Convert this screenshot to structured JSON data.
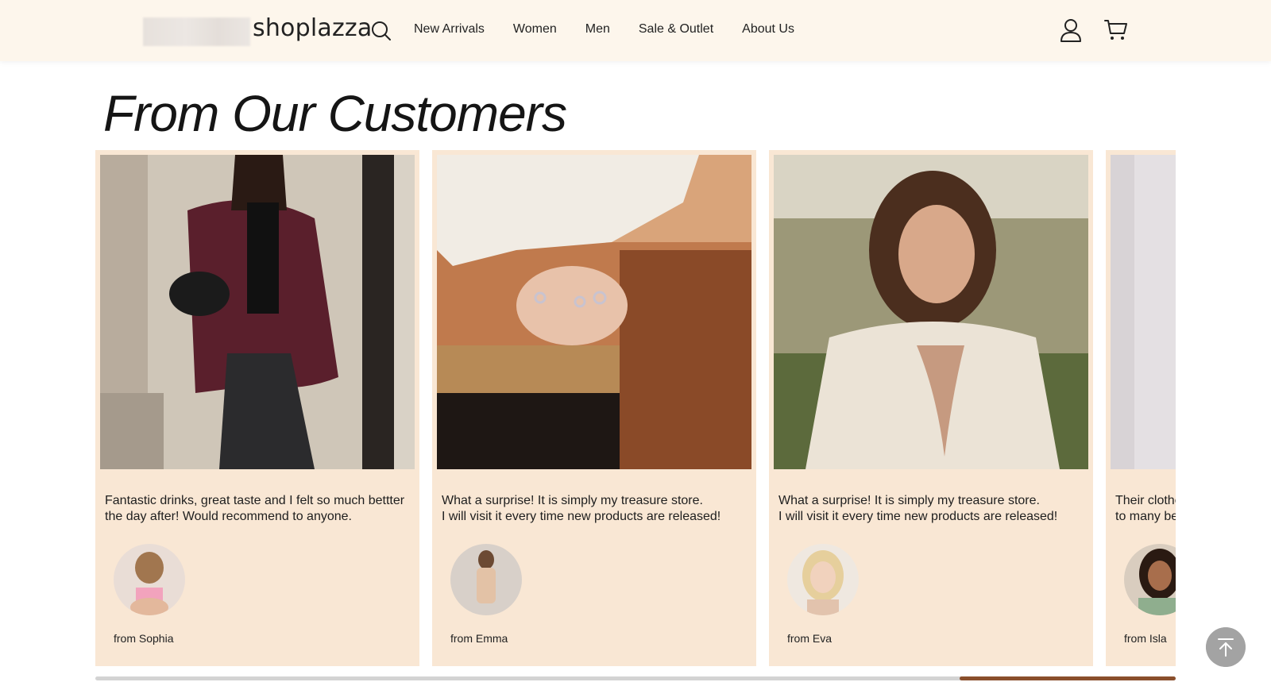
{
  "header": {
    "logo_text": "shoplazza",
    "nav": [
      "New Arrivals",
      "Women",
      "Men",
      "Sale & Outlet",
      "About Us"
    ],
    "icons": [
      "search-icon",
      "account-icon",
      "cart-icon"
    ]
  },
  "section": {
    "title": "From Our Customers"
  },
  "reviews": [
    {
      "text": "Fantastic drinks, great taste and I felt so much bettter\nthe day after! Would recommend to anyone.",
      "author": "from Sophia"
    },
    {
      "text": "What a surprise! It is simply my treasure store.\nI will visit it every time new products are released!",
      "author": "from Emma"
    },
    {
      "text": "What a surprise! It is simply my treasure store.\nI will visit it every time new products are released!",
      "author": "from Eva"
    },
    {
      "text": "Their clothes are so fashionable, I recommend them\nto many beautiful women around me!",
      "author": "from Isla"
    }
  ],
  "scroll_progress": 0.81,
  "colors": {
    "header_bg": "#fdf6ec",
    "card_bg": "#f9e7d4",
    "scroll_thumb": "#8a4f2c",
    "back_to_top": "#9a9a9a"
  }
}
